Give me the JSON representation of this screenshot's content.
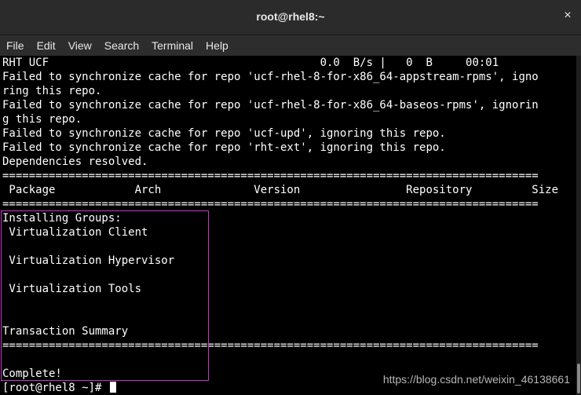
{
  "window": {
    "title": "root@rhel8:~",
    "close_icon": "×"
  },
  "menu": [
    "File",
    "Edit",
    "View",
    "Search",
    "Terminal",
    "Help"
  ],
  "terminal": {
    "lines": [
      "RHT UCF                                         0.0  B/s |   0  B     00:01",
      "Failed to synchronize cache for repo 'ucf-rhel-8-for-x86_64-appstream-rpms', igno",
      "ring this repo.",
      "Failed to synchronize cache for repo 'ucf-rhel-8-for-x86_64-baseos-rpms', ignorin",
      "g this repo.",
      "Failed to synchronize cache for repo 'ucf-upd', ignoring this repo.",
      "Failed to synchronize cache for repo 'rht-ext', ignoring this repo.",
      "Dependencies resolved.",
      "=================================================================================",
      " Package            Arch              Version                Repository         Size",
      "=================================================================================",
      "Installing Groups:",
      " Virtualization Client",
      "",
      " Virtualization Hypervisor",
      "",
      " Virtualization Tools",
      "",
      "",
      "Transaction Summary",
      "=================================================================================",
      "",
      "Complete!"
    ],
    "prompt": "[root@rhel8 ~]# "
  },
  "watermark": "https://blog.csdn.net/weixin_46138661"
}
